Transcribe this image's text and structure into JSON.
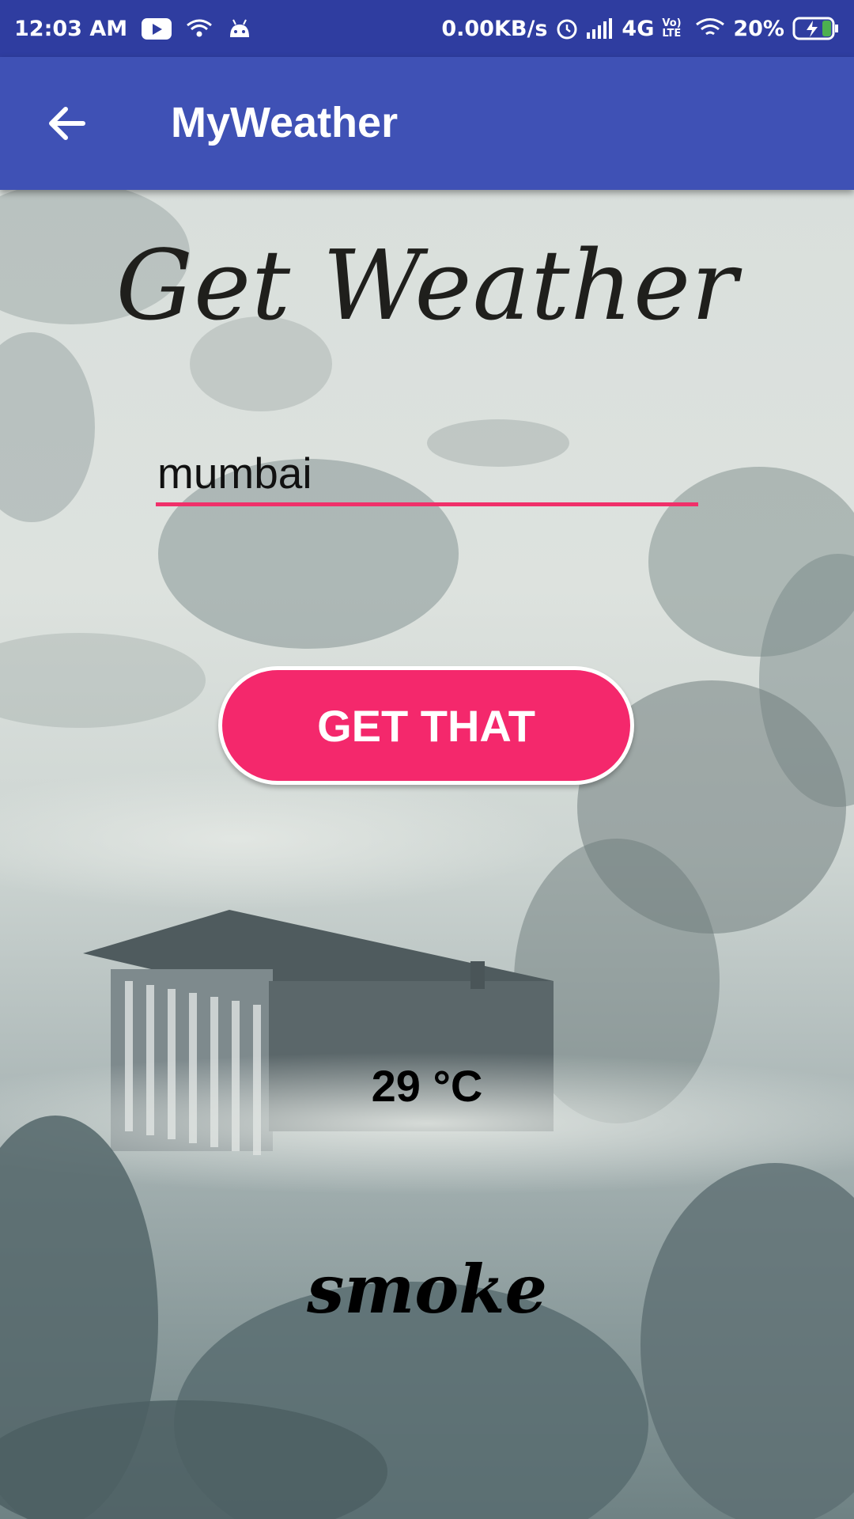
{
  "status_bar": {
    "time": "12:03 AM",
    "network_speed": "0.00KB/s",
    "network_type": "4G",
    "volte": "Vo) LTE",
    "battery": "20%"
  },
  "app_bar": {
    "title": "MyWeather",
    "back_icon": "arrow-left-icon"
  },
  "main": {
    "heading": "Get Weather",
    "city_input": {
      "value": "mumbai",
      "placeholder": ""
    },
    "button_label": "GET THAT",
    "temperature": "29 °C",
    "condition": "smoke"
  },
  "colors": {
    "status_bar": "#2f3da0",
    "app_bar": "#3f51b5",
    "accent": "#f4286c"
  }
}
